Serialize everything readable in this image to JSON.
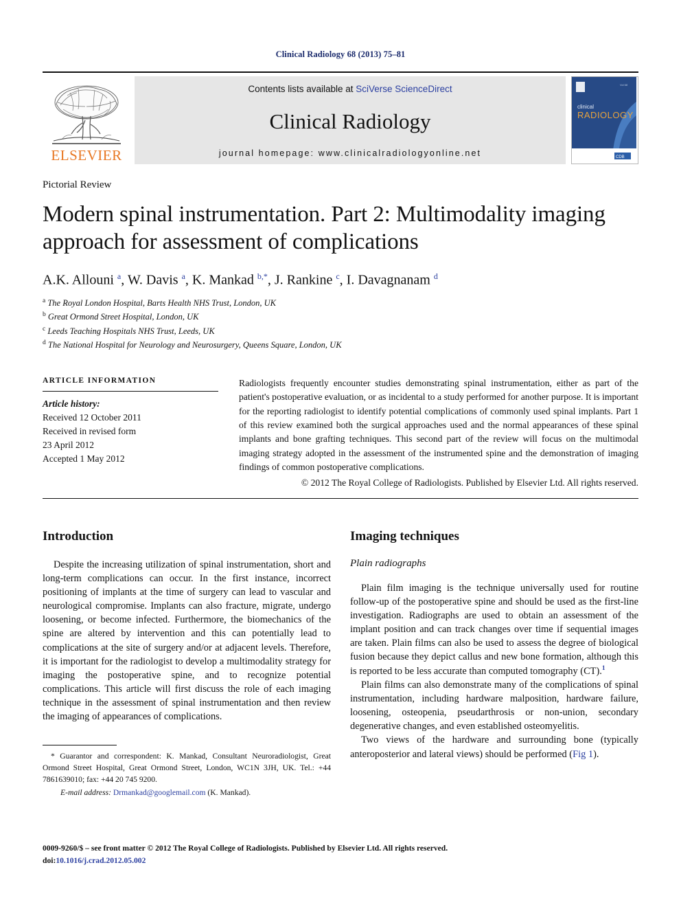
{
  "running_head": "Clinical Radiology 68 (2013) 75–81",
  "header": {
    "publisher_name": "ELSEVIER",
    "contents_prefix": "Contents lists available at ",
    "contents_link": "SciVerse ScienceDirect",
    "journal_title": "Clinical Radiology",
    "homepage": "journal homepage: www.clinicalradiologyonline.net",
    "cover": {
      "line1": "clinical",
      "line2": "RADIOLOGY",
      "badge": "CDB"
    }
  },
  "article": {
    "type": "Pictorial Review",
    "title": "Modern spinal instrumentation. Part 2: Multimodality imaging approach for assessment of complications",
    "authors_html": "A.K. Allouni <sup>a</sup>, W. Davis <sup>a</sup>, K. Mankad <sup>b,*</sup>, J. Rankine <sup>c</sup>, I. Davagnanam <sup>d</sup>",
    "affiliations": [
      {
        "marker": "a",
        "text": "The Royal London Hospital, Barts Health NHS Trust, London, UK"
      },
      {
        "marker": "b",
        "text": "Great Ormond Street Hospital, London, UK"
      },
      {
        "marker": "c",
        "text": "Leeds Teaching Hospitals NHS Trust, Leeds, UK"
      },
      {
        "marker": "d",
        "text": "The National Hospital for Neurology and Neurosurgery, Queens Square, London, UK"
      }
    ]
  },
  "article_info": {
    "heading": "ARTICLE INFORMATION",
    "history_label": "Article history:",
    "history_lines": [
      "Received 12 October 2011",
      "Received in revised form",
      "23 April 2012",
      "Accepted 1 May 2012"
    ]
  },
  "abstract": {
    "text": "Radiologists frequently encounter studies demonstrating spinal instrumentation, either as part of the patient's postoperative evaluation, or as incidental to a study performed for another purpose. It is important for the reporting radiologist to identify potential complications of commonly used spinal implants. Part 1 of this review examined both the surgical approaches used and the normal appearances of these spinal implants and bone grafting techniques. This second part of the review will focus on the multimodal imaging strategy adopted in the assessment of the instrumented spine and the demonstration of imaging findings of common postoperative complications.",
    "copyright": "© 2012 The Royal College of Radiologists. Published by Elsevier Ltd. All rights reserved."
  },
  "body": {
    "left": {
      "heading": "Introduction",
      "paragraph": "Despite the increasing utilization of spinal instrumentation, short and long-term complications can occur. In the first instance, incorrect positioning of implants at the time of surgery can lead to vascular and neurological compromise. Implants can also fracture, migrate, undergo loosening, or become infected. Furthermore, the biomechanics of the spine are altered by intervention and this can potentially lead to complications at the site of surgery and/or at adjacent levels. Therefore, it is important for the radiologist to develop a multimodality strategy for imaging the postoperative spine, and to recognize potential complications. This article will first discuss the role of each imaging technique in the assessment of spinal instrumentation and then review the imaging of appearances of complications."
    },
    "right": {
      "heading": "Imaging techniques",
      "subheading": "Plain radiographs",
      "paragraph1_before_ref": "Plain film imaging is the technique universally used for routine follow-up of the postoperative spine and should be used as the first-line investigation. Radiographs are used to obtain an assessment of the implant position and can track changes over time if sequential images are taken. Plain films can also be used to assess the degree of biological fusion because they depict callus and new bone formation, although this is reported to be less accurate than computed tomography (CT).",
      "paragraph1_ref": "1",
      "paragraph2": "Plain films can also demonstrate many of the complications of spinal instrumentation, including hardware malposition, hardware failure, loosening, osteopenia, pseudarthrosis or non-union, secondary degenerative changes, and even established osteomyelitis.",
      "paragraph3_before_link": "Two views of the hardware and surrounding bone (typically anteroposterior and lateral views) should be performed (",
      "paragraph3_link": "Fig 1",
      "paragraph3_after_link": ")."
    }
  },
  "footnote": {
    "text": "* Guarantor and correspondent: K. Mankad, Consultant Neuroradiologist, Great Ormond Street Hospital, Great Ormond Street, London, WC1N 3JH, UK. Tel.: +44 7861639010; fax: +44 20 745 9200.",
    "email_label": "E-mail address:",
    "email": "Drmankad@googlemail.com",
    "email_suffix": "(K. Mankad)."
  },
  "page_footer": {
    "line1": "0009-9260/$ – see front matter © 2012 The Royal College of Radiologists. Published by Elsevier Ltd. All rights reserved.",
    "doi_prefix": "doi:",
    "doi": "10.1016/j.crad.2012.05.002"
  },
  "colors": {
    "link": "#2b3fa0",
    "running_head": "#1a2a6c",
    "elsevier_orange": "#e87722",
    "band_gray": "#e6e6e6",
    "cover_navy": "#1f3f7a",
    "cover_blue": "#3f6fb5"
  }
}
